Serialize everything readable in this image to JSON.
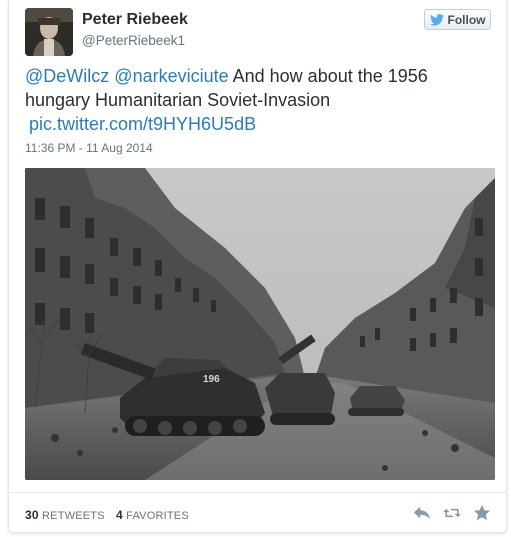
{
  "user": {
    "display_name": "Peter Riebeek",
    "handle": "@PeterRiebeek1"
  },
  "follow_label": "Follow",
  "tweet": {
    "mention_1": "@DeWilcz",
    "mention_2": "@narkeviciute",
    "text": " And how about the 1956 hungary Humanitarian Soviet-Invasion",
    "link": "pic.twitter.com/t9HYH6U5dB",
    "timestamp": "11:36 PM - 11 Aug 2014"
  },
  "photo": {
    "tank_number": "196"
  },
  "stats": {
    "retweets_count": "30",
    "retweets_label": "RETWEETS",
    "favorites_count": "4",
    "favorites_label": "FAVORITES"
  },
  "icons": {
    "reply": "reply-icon",
    "retweet": "retweet-icon",
    "favorite": "star-icon",
    "follow": "twitter-bird-icon"
  },
  "colors": {
    "link": "#2b7bb9",
    "text": "#292f33",
    "muted": "#66757f",
    "icon": "#8899a6"
  }
}
